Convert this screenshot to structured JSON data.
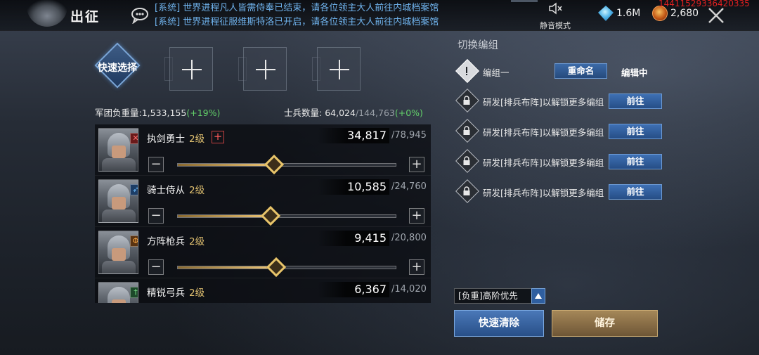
{
  "header": {
    "title": "出征",
    "news": [
      "[系统] 世界进程凡人皆需侍奉已结束，请各位领主大人前往内城档案馆",
      "[系统] 世界进程征服维斯特洛已开启，请各位领主大人前往内城档案馆"
    ],
    "mute_label": "静音模式",
    "gems": "1.6M",
    "coins": "2,680",
    "debug_id": "14411529336420335"
  },
  "formation": {
    "quick_select_label": "快速选择",
    "slot_count": 3
  },
  "stats": {
    "legion_load_label": "军团负重量:",
    "legion_load_value": "1,533,155",
    "legion_load_bonus": "(+19%)",
    "soldier_count_label": "士兵数量:",
    "soldier_count_value": "64,024",
    "soldier_count_max": "/144,763",
    "soldier_count_bonus": "(+0%)"
  },
  "troops": [
    {
      "name": "执剑勇士",
      "level": "2级",
      "count": "34,817",
      "max": "/78,945",
      "badge": "✕",
      "fill": 0.441
    },
    {
      "name": "骑士侍从",
      "level": "2级",
      "count": "10,585",
      "max": "/24,760",
      "badge": "➶",
      "fill": 0.427
    },
    {
      "name": "方阵枪兵",
      "level": "2级",
      "count": "9,415",
      "max": "/20,800",
      "badge": "Φ",
      "fill": 0.453
    },
    {
      "name": "精锐弓兵",
      "level": "2级",
      "count": "6,367",
      "max": "/14,020",
      "badge": "†",
      "fill": 0.454
    }
  ],
  "groups": {
    "title": "切换编组",
    "active_label": "编组一",
    "rename_label": "重命名",
    "editing_label": "编辑中",
    "locked": [
      {
        "label": "研发[排兵布阵]以解锁更多编组",
        "button": "前往"
      },
      {
        "label": "研发[排兵布阵]以解锁更多编组",
        "button": "前往"
      },
      {
        "label": "研发[排兵布阵]以解锁更多编组",
        "button": "前往"
      },
      {
        "label": "研发[排兵布阵]以解锁更多编组",
        "button": "前往"
      }
    ]
  },
  "actions": {
    "priority_label": "[负重]高阶优先",
    "quick_clear_label": "快速清除",
    "save_label": "储存"
  }
}
